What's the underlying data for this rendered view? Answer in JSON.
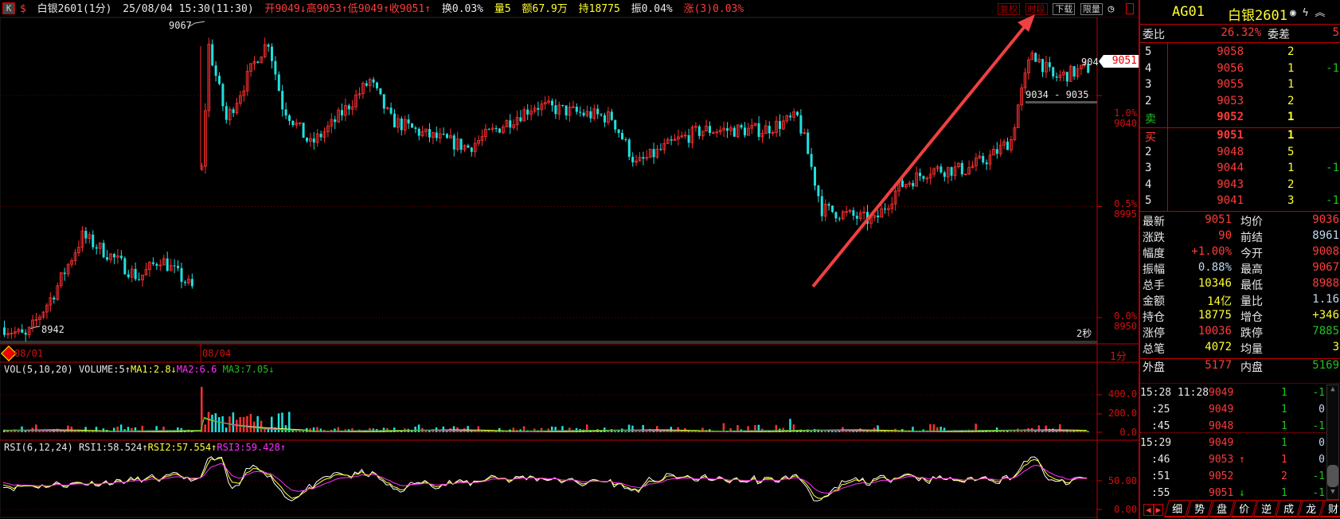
{
  "topbar": {
    "k_label": "K",
    "dollar": "$",
    "symbol": "白银2601(1分)",
    "datetime": "25/08/04 15:30(11:30)",
    "open": "开9049↓",
    "high": "高9053↑",
    "low": "低9049↑",
    "close": "收9051↑",
    "turnover": "换0.03%",
    "volume": "量5",
    "amount": "额67.9万",
    "hold": "持18775",
    "amplitude": "振0.04%",
    "change": "涨(3)0.03%",
    "buttons": [
      "复权",
      "时段",
      "下载",
      "限量"
    ]
  },
  "main_chart": {
    "high_label": "9067",
    "low_label": "8942",
    "range_label": "9034 - 9035",
    "price_tag": "9051",
    "partial_label": "904",
    "seconds": "2秒",
    "yaxis": [
      {
        "pct": "1.0%",
        "price": "9040"
      },
      {
        "pct": "0.5%",
        "price": "8995"
      },
      {
        "pct": "0.0%",
        "price": "8950"
      }
    ],
    "dates": [
      "08/01",
      "08/04"
    ],
    "period": "1分"
  },
  "chart_data": {
    "type": "candlestick",
    "note": "approximate close-price waypoints (minute index, price)",
    "day1": [
      [
        0,
        8946
      ],
      [
        6,
        8942
      ],
      [
        14,
        8960
      ],
      [
        22,
        8983
      ],
      [
        30,
        8975
      ],
      [
        38,
        8966
      ],
      [
        44,
        8974
      ],
      [
        53,
        8962
      ]
    ],
    "day2": [
      [
        0,
        9010
      ],
      [
        2,
        9060
      ],
      [
        7,
        9030
      ],
      [
        16,
        9056
      ],
      [
        19,
        9062
      ],
      [
        23,
        9036
      ],
      [
        31,
        9020
      ],
      [
        37,
        9028
      ],
      [
        48,
        9046
      ],
      [
        54,
        9030
      ],
      [
        64,
        9024
      ],
      [
        76,
        9019
      ],
      [
        88,
        9030
      ],
      [
        95,
        9036
      ],
      [
        107,
        9033
      ],
      [
        117,
        9031
      ],
      [
        124,
        9012
      ],
      [
        136,
        9022
      ],
      [
        143,
        9026
      ],
      [
        160,
        9026
      ],
      [
        170,
        9031
      ],
      [
        172,
        9022
      ],
      [
        177,
        8994
      ],
      [
        192,
        8989
      ],
      [
        199,
        9003
      ],
      [
        208,
        9010
      ],
      [
        218,
        9010
      ],
      [
        225,
        9015
      ],
      [
        231,
        9022
      ],
      [
        233,
        9036
      ],
      [
        237,
        9058
      ],
      [
        243,
        9047
      ],
      [
        253,
        9051
      ]
    ]
  },
  "volume": {
    "title": "VOL(5,10,20)",
    "volume": "VOLUME:5↑",
    "ma1": "MA1:2.8↓",
    "ma2": "MA2:6.6",
    "ma3": "MA3:7.05↓",
    "yaxis": [
      "400.0",
      "200.0",
      "0.0"
    ]
  },
  "rsi": {
    "title": "RSI(6,12,24)",
    "rsi1": "RSI1:58.524↑",
    "rsi2": "RSI2:57.554↑",
    "rsi3": "RSI3:59.428↑",
    "yaxis": [
      "50.00",
      "0.00"
    ]
  },
  "panel": {
    "code": "AG01",
    "name": "白银2601",
    "weibi_label": "委比",
    "weibi": "26.32%",
    "weicha_label": "委差",
    "weicha": "5",
    "asks": [
      {
        "lv": "5",
        "p": "9058",
        "v": "2",
        "c": ""
      },
      {
        "lv": "4",
        "p": "9056",
        "v": "1",
        "c": "-1"
      },
      {
        "lv": "3",
        "p": "9055",
        "v": "1",
        "c": ""
      },
      {
        "lv": "2",
        "p": "9053",
        "v": "2",
        "c": ""
      },
      {
        "lv": "卖",
        "p": "9052",
        "v": "1",
        "c": ""
      }
    ],
    "bids": [
      {
        "lv": "买",
        "p": "9051",
        "v": "1",
        "c": ""
      },
      {
        "lv": "2",
        "p": "9048",
        "v": "5",
        "c": ""
      },
      {
        "lv": "3",
        "p": "9044",
        "v": "1",
        "c": "-1"
      },
      {
        "lv": "4",
        "p": "9043",
        "v": "2",
        "c": ""
      },
      {
        "lv": "5",
        "p": "9041",
        "v": "3",
        "c": "-1"
      }
    ],
    "stats": [
      [
        "最新",
        "9051",
        "r",
        "均价",
        "9036",
        "r"
      ],
      [
        "涨跌",
        "90",
        "r",
        "前结",
        "8961",
        "b"
      ],
      [
        "幅度",
        "+1.00%",
        "r",
        "今开",
        "9008",
        "r"
      ],
      [
        "振幅",
        "0.88%",
        "b",
        "最高",
        "9067",
        "r"
      ],
      [
        "总手",
        "10346",
        "y",
        "最低",
        "8988",
        "r"
      ],
      [
        "金额",
        "14亿",
        "y",
        "量比",
        "1.16",
        "b"
      ],
      [
        "持仓",
        "18775",
        "y",
        "增仓",
        "+346",
        "y"
      ],
      [
        "涨停",
        "10036",
        "r",
        "跌停",
        "7885",
        "g"
      ],
      [
        "总笔",
        "4072",
        "y",
        "均量",
        "3",
        "y"
      ]
    ],
    "outer_label": "外盘",
    "outer": "5177",
    "inner_label": "内盘",
    "inner": "5169",
    "ticks": [
      {
        "t": "15:28 11:28",
        "p": "9049",
        "a": "",
        "v": "1",
        "vc": "g",
        "c": "-1"
      },
      {
        "t": ":25",
        "p": "9049",
        "a": "",
        "v": "1",
        "vc": "g",
        "c": "0"
      },
      {
        "t": ":45",
        "p": "9048",
        "a": "",
        "v": "1",
        "vc": "g",
        "c": "-1"
      },
      {
        "t": "15:29",
        "p": "9049",
        "a": "",
        "v": "1",
        "vc": "g",
        "c": "0"
      },
      {
        "t": ":46",
        "p": "9053",
        "a": "↑",
        "v": "1",
        "vc": "r",
        "c": "0"
      },
      {
        "t": ":51",
        "p": "9052",
        "a": "",
        "v": "2",
        "vc": "r",
        "c": "-1"
      },
      {
        "t": ":55",
        "p": "9051",
        "a": "↓",
        "v": "1",
        "vc": "g",
        "c": "-1"
      }
    ],
    "tabs": [
      "细",
      "势",
      "盘",
      "价",
      "逆",
      "成",
      "龙",
      "财"
    ]
  }
}
